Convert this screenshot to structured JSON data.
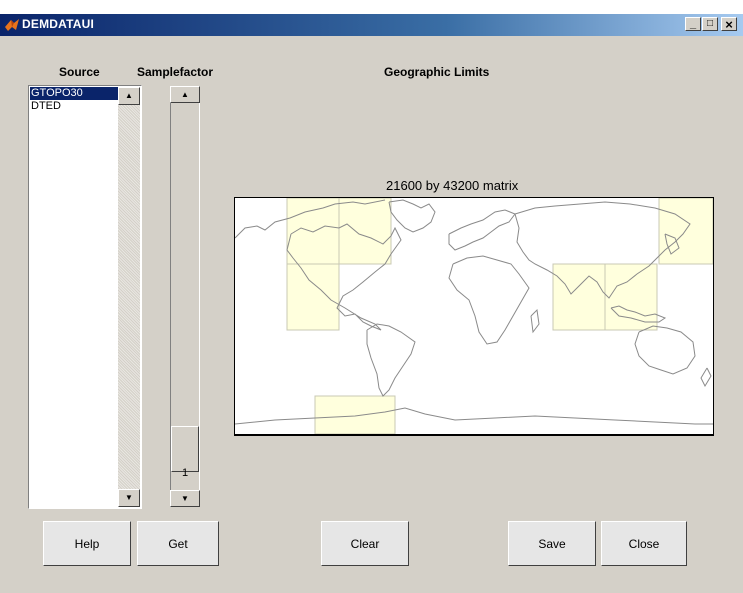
{
  "window": {
    "title": "DEMDATAUI",
    "controls": {
      "minimize": "_",
      "maximize": "□",
      "close": "×"
    }
  },
  "labels": {
    "source": "Source",
    "samplefactor": "Samplefactor",
    "geographic_limits": "Geographic Limits"
  },
  "source_list": {
    "items": [
      "GTOPO30",
      "DTED"
    ],
    "selected": "GTOPO30"
  },
  "samplefactor": {
    "value": "1"
  },
  "map": {
    "matrix_label": "21600 by 43200 matrix",
    "tile_fill": "#ffffdd",
    "tile_stroke": "#c8c8b4",
    "coast_color": "#8a8a8a"
  },
  "buttons": {
    "help": "Help",
    "get": "Get",
    "clear": "Clear",
    "save": "Save",
    "close": "Close"
  },
  "colors": {
    "face": "#d4d0c8",
    "selection": "#0a246a",
    "titlebar": "#0a246a"
  }
}
